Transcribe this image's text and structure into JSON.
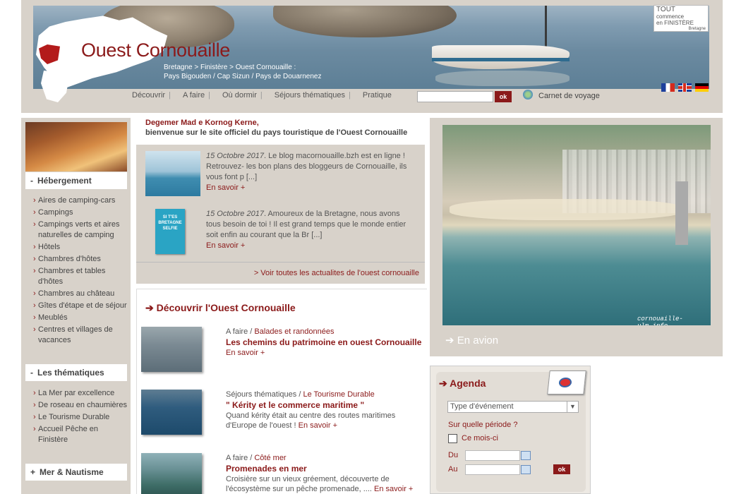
{
  "header": {
    "title": "Ouest Cornouaille",
    "breadcrumb": "Bretagne > Finistère > Ouest Cornouaille :",
    "subtitle": "Pays Bigouden / Cap Sizun / Pays de Douarnenez",
    "logo": {
      "line1": "TOUT",
      "line2": "commence",
      "line3": "en FINISTÈRE",
      "line4": "Bretagne"
    },
    "nav": [
      "Découvrir",
      "A faire",
      "Où dormir",
      "Séjours thématiques",
      "Pratique"
    ],
    "search_button": "ok",
    "carnet": "Carnet de voyage",
    "flags": [
      "fr",
      "en",
      "de"
    ]
  },
  "sidebar": {
    "sections": [
      {
        "sign": "-",
        "title": "Hébergement",
        "items": [
          "Aires de camping-cars",
          "Campings",
          "Campings verts et aires naturelles de camping",
          "Hôtels",
          "Chambres d'hôtes",
          "Chambres et tables d'hôtes",
          "Chambres au château",
          "Gîtes d'étape et de séjour",
          "Meublés",
          "Centres et villages de vacances"
        ]
      },
      {
        "sign": "-",
        "title": "Les thématiques",
        "items": [
          "La Mer par excellence",
          "De roseau en chaumières",
          "Le Tourisme Durable",
          "Accueil Pêche en Finistère"
        ]
      },
      {
        "sign": "+",
        "title": "Mer & Nautisme",
        "items": []
      }
    ]
  },
  "greeting": {
    "line1": "Degemer Mad e Kornog Kerne,",
    "line2": "bienvenue sur le site officiel du pays touristique de l'Ouest Cornouaille"
  },
  "news": {
    "items": [
      {
        "date": "15 Octobre 2017",
        "text": ". Le blog macornouaille.bzh est en ligne ! Retrouvez- les bon plans des bloggeurs de Cornouaille, ils vous font p [...]",
        "more": "En savoir +"
      },
      {
        "date": "15 Octobre 2017",
        "text": ". Amoureux de la Bretagne, nous avons tous besoin de toi ! Il est grand temps que le monde entier soit enfin au courant que la Br [...]",
        "more": "En savoir +",
        "thumb_text": "SI T'ES BRETAGNE SELFIE"
      }
    ],
    "all_link": "> Voir toutes les actualites de l'ouest cornouaille"
  },
  "decouvrir": {
    "title": "➔ Découvrir l'Ouest Cornouaille",
    "items": [
      {
        "cat_a": "A faire",
        "cat_b": "Balades et randonnées",
        "title": "Les chemins du patrimoine en ouest Cornouaille",
        "desc": "",
        "more": "En savoir +"
      },
      {
        "cat_a": "Séjours thématiques",
        "cat_b": "Le Tourisme Durable",
        "title": "\" Kérity et le commerce maritime \"",
        "desc": "Quand kérity était au centre des routes maritimes d'Europe de l'ouest ! ",
        "more": "En savoir +"
      },
      {
        "cat_a": "A faire",
        "cat_b": "Côté mer",
        "title": "Promenades en mer",
        "desc": "Croisière sur un vieux gréement, découverte de l'écosystème sur un pêche promenade, .... ",
        "more": "En savoir +"
      }
    ]
  },
  "photo": {
    "caption": "➔ En avion",
    "credit": "cornouaille-ulm.info"
  },
  "agenda": {
    "title": "➔ Agenda",
    "select_value": "Type d'événement",
    "period_label": "Sur quelle période ?",
    "checkbox_label": "Ce mois-ci",
    "du": "Du",
    "au": "Au",
    "ok": "ok"
  }
}
